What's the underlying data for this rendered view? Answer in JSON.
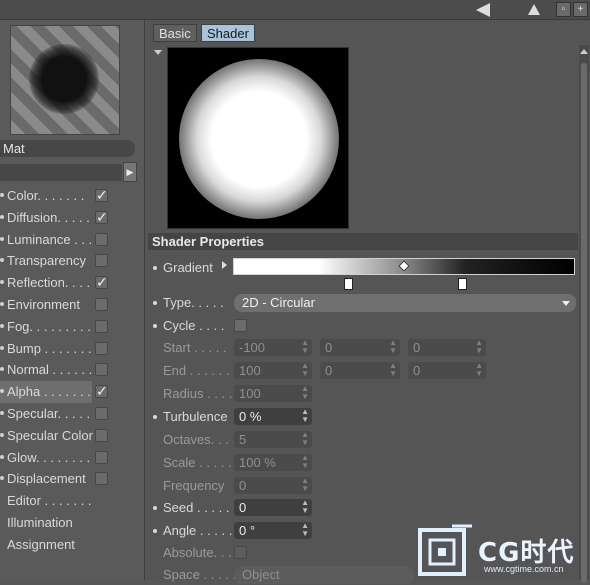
{
  "topbar": {
    "icons": [
      "arrow-left-icon",
      "up-arrow-icon",
      "window-icon",
      "plus-icon"
    ]
  },
  "material": {
    "name": "Mat"
  },
  "channels": [
    {
      "label": "Color. . . . . . .",
      "checked": true
    },
    {
      "label": "Diffusion. . . . .",
      "checked": true
    },
    {
      "label": "Luminance . . . .",
      "checked": false
    },
    {
      "label": "Transparency",
      "checked": false
    },
    {
      "label": "Reflection. . . .",
      "checked": true
    },
    {
      "label": "Environment",
      "checked": false
    },
    {
      "label": "Fog. . . . . . . . .",
      "checked": false
    },
    {
      "label": "Bump . . . . . . .",
      "checked": false
    },
    {
      "label": "Normal . . . . . .",
      "checked": false
    },
    {
      "label": "Alpha . . . . . . .",
      "checked": true,
      "active": true
    },
    {
      "label": "Specular. . . . .",
      "checked": false
    },
    {
      "label": "Specular Color",
      "checked": false
    },
    {
      "label": "Glow. . . . . . . .",
      "checked": false
    },
    {
      "label": "Displacement",
      "checked": false
    },
    {
      "label": "Editor . . . . . . ."
    },
    {
      "label": "Illumination"
    },
    {
      "label": "Assignment"
    }
  ],
  "tabs": [
    {
      "label": "Basic",
      "selected": false
    },
    {
      "label": "Shader",
      "selected": true
    }
  ],
  "section": {
    "title": "Shader Properties"
  },
  "props": {
    "gradient_label": "Gradient",
    "type_label": "Type. . . . .",
    "type_value": "2D - Circular",
    "cycle_label": "Cycle . . . .",
    "start_label": "Start . . . . .",
    "start_values": [
      "-100",
      "0",
      "0"
    ],
    "end_label": "End . . . . . .",
    "end_values": [
      "100",
      "0",
      "0"
    ],
    "radius_label": "Radius . . . .",
    "radius_value": "100",
    "turbulence_label": "Turbulence",
    "turbulence_value": "0 %",
    "octaves_label": "Octaves. . . .",
    "octaves_value": "5",
    "scale_label": "Scale . . . . .",
    "scale_value": "100 %",
    "frequency_label": "Frequency",
    "frequency_value": "0",
    "seed_label": "Seed . . . . .",
    "seed_value": "0",
    "angle_label": "Angle . . . . .",
    "angle_value": "0 °",
    "absolute_label": "Absolute. . .",
    "space_label": "Space . . . . .",
    "space_value": "Object"
  },
  "watermark": {
    "brand": "CG时代",
    "url": "www.cgtime.com.cn"
  }
}
